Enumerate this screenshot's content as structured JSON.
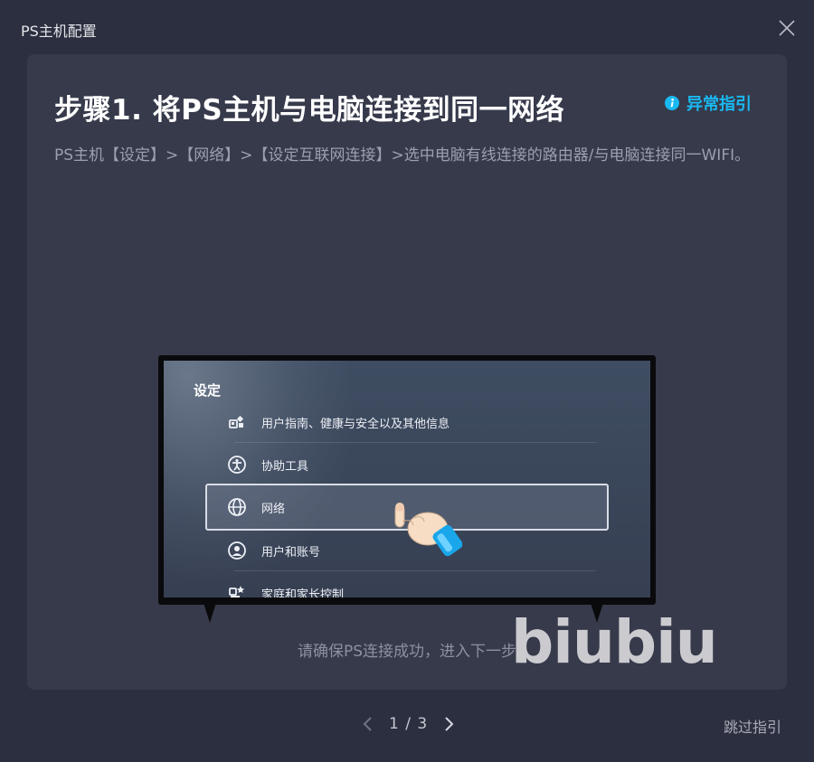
{
  "window": {
    "title": "PS主机配置",
    "close_icon": "close-icon"
  },
  "step": {
    "title": "步骤1. 将PS主机与电脑连接到同一网络",
    "help_label": "异常指引",
    "help_icon": "info-icon",
    "description": "PS主机【设定】>【网络】>【设定互联网连接】>选中电脑有线连接的路由器/与电脑连接同一WIFI。"
  },
  "tv_screen": {
    "heading": "设定",
    "items": [
      {
        "label": "用户指南、健康与安全以及其他信息",
        "icon": "info-bits-icon"
      },
      {
        "label": "协助工具",
        "icon": "accessibility-icon"
      },
      {
        "label": "网络",
        "icon": "globe-icon",
        "selected": true
      },
      {
        "label": "用户和账号",
        "icon": "user-icon"
      },
      {
        "label": "家庭和家长控制",
        "icon": "family-icon"
      }
    ]
  },
  "hint": "请确保PS连接成功，进入下一步",
  "watermark": "biubiu",
  "pager": {
    "text": "1 / 3",
    "current": 1,
    "total": 3,
    "prev_icon": "chevron-left-icon",
    "next_icon": "chevron-right-icon"
  },
  "skip_label": "跳过指引",
  "colors": {
    "background": "#2c2f3f",
    "card": "#363a4b",
    "accent": "#19b9f2",
    "hand_cuff": "#1aa6ea"
  }
}
